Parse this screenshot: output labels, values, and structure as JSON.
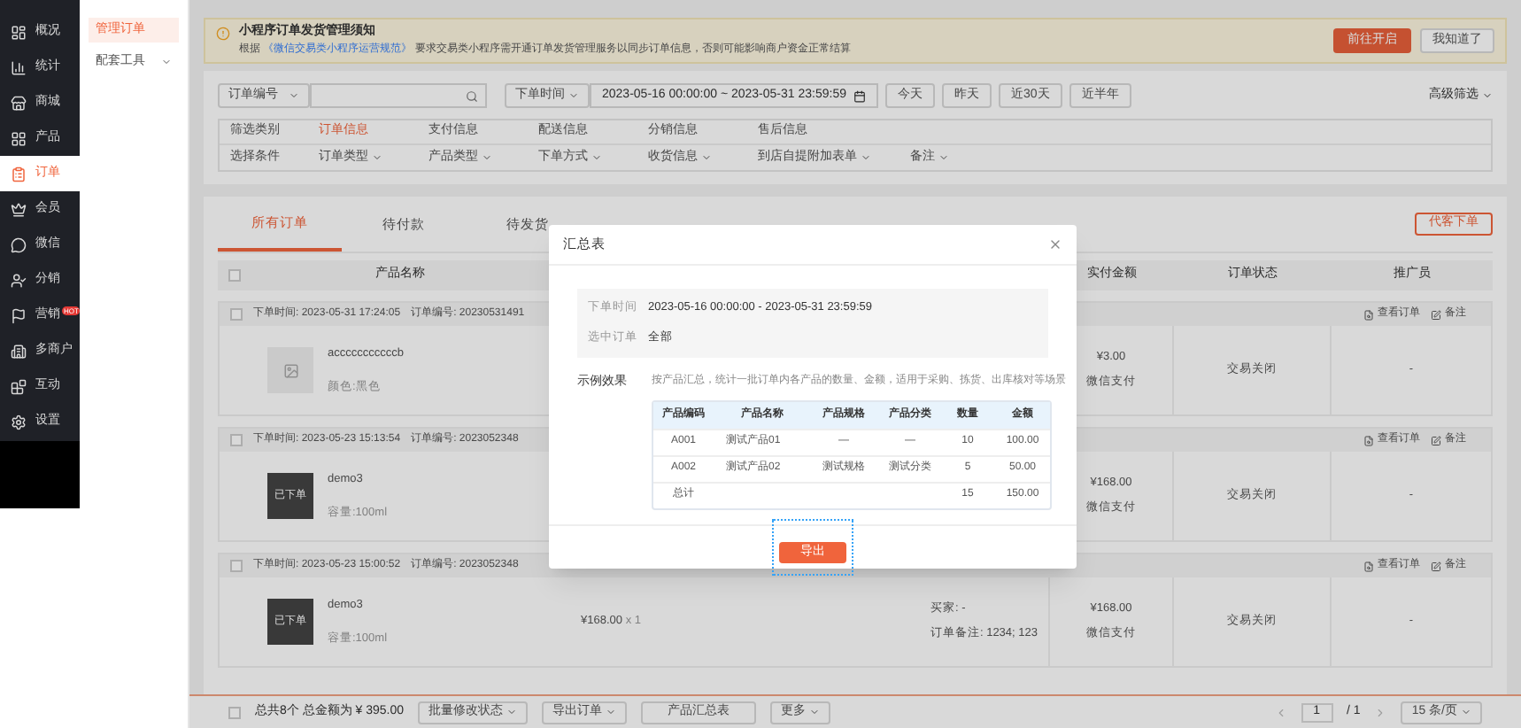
{
  "sidebar": {
    "items": [
      {
        "label": "概况",
        "selected": false
      },
      {
        "label": "统计",
        "selected": false
      },
      {
        "label": "商城",
        "selected": false
      },
      {
        "label": "产品",
        "selected": false
      },
      {
        "label": "订单",
        "selected": true
      },
      {
        "label": "会员",
        "selected": false
      },
      {
        "label": "微信",
        "selected": false
      },
      {
        "label": "分销",
        "selected": false
      },
      {
        "label": "营销",
        "selected": false,
        "badge": "HOT"
      },
      {
        "label": "多商户",
        "selected": false
      },
      {
        "label": "互动",
        "selected": false
      },
      {
        "label": "设置",
        "selected": false
      }
    ]
  },
  "subnav": {
    "items": [
      {
        "label": "管理订单",
        "selected": true,
        "expandable": false
      },
      {
        "label": "配套工具",
        "selected": false,
        "expandable": true
      }
    ]
  },
  "notice": {
    "title": "小程序订单发货管理须知",
    "text_before": "根据",
    "link": "《微信交易类小程序运营规范》",
    "text_after": "要求交易类小程序需开通订单发货管理服务以同步订单信息，否则可能影响商户资金正常结算",
    "primary_button": "前往开启",
    "secondary_button": "我知道了"
  },
  "filters": {
    "field_select": "订单编号",
    "time_select": "下单时间",
    "date_range": "2023-05-16 00:00:00 ~ 2023-05-31 23:59:59",
    "quick_buttons": [
      "今天",
      "昨天",
      "近30天",
      "近半年"
    ],
    "advanced": "高级筛选",
    "category_label": "筛选类别",
    "categories": [
      {
        "label": "订单信息",
        "selected": true
      },
      {
        "label": "支付信息",
        "selected": false
      },
      {
        "label": "配送信息",
        "selected": false
      },
      {
        "label": "分销信息",
        "selected": false
      },
      {
        "label": "售后信息",
        "selected": false
      }
    ],
    "condition_label": "选择条件",
    "conditions": [
      "订单类型",
      "产品类型",
      "下单方式",
      "收货信息",
      "到店自提附加表单",
      "备注"
    ]
  },
  "orders": {
    "tabs": [
      {
        "label": "所有订单",
        "selected": true
      },
      {
        "label": "待付款",
        "selected": false
      },
      {
        "label": "待发货",
        "selected": false
      }
    ],
    "proxy_button": "代客下单",
    "select_all_checked": false,
    "columns": {
      "product": "产品名称",
      "paid": "实付金额",
      "status": "订单状态",
      "promoter": "推广员"
    },
    "rows": [
      {
        "time_label": "下单时间:",
        "time": "2023-05-31 17:24:05",
        "number_label": "订单编号:",
        "number": "20230531491",
        "checked": false,
        "product": "acccccccccccb",
        "spec": "颜色:黑色",
        "kind": "placeholder",
        "paid": "¥3.00",
        "pay_method": "微信支付",
        "status": "交易关闭",
        "promoter": "-",
        "view": "查看订单",
        "remark": "备注"
      },
      {
        "time_label": "下单时间:",
        "time": "2023-05-23 15:13:54",
        "number_label": "订单编号:",
        "number": "2023052348",
        "checked": false,
        "product": "demo3",
        "spec": "容量:100ml",
        "kind": "thumbnail",
        "thumbnail_text": "已下单",
        "paid": "¥168.00",
        "pay_method": "微信支付",
        "status": "交易关闭",
        "promoter": "-",
        "view": "查看订单",
        "remark": "备注"
      },
      {
        "time_label": "下单时间:",
        "time": "2023-05-23 15:00:52",
        "number_label": "订单编号:",
        "number": "2023052348",
        "checked": false,
        "product": "demo3",
        "spec": "容量:100ml",
        "kind": "thumbnail",
        "thumbnail_text": "已下单",
        "price": "¥168.00",
        "qty": "x 1",
        "buyer": "买家: -",
        "order_note": "订单备注: 1234; 123",
        "paid": "¥168.00",
        "pay_method": "微信支付",
        "status": "交易关闭",
        "promoter": "-",
        "view": "查看订单",
        "remark": "备注"
      }
    ]
  },
  "footer": {
    "select_all_checked": false,
    "summary": "总共8个 总金额为 ¥ 395.00",
    "buttons": [
      "批量修改状态",
      "导出订单",
      "产品汇总表",
      "更多"
    ],
    "page": "1",
    "pages": "/ 1",
    "page_size": "15 条/页"
  },
  "dialog": {
    "title": "汇总表",
    "info": [
      {
        "label": "下单时间",
        "value": "2023-05-16 00:00:00 - 2023-05-31 23:59:59"
      },
      {
        "label": "选中订单",
        "value": "全部"
      }
    ],
    "example_label": "示例效果",
    "description": "按产品汇总，统计一批订单内各产品的数量、金额，适用于采购、拣货、出库核对等场景",
    "table": {
      "columns": [
        "产品编码",
        "产品名称",
        "产品规格",
        "产品分类",
        "数量",
        "金额"
      ],
      "rows": [
        [
          "A001",
          "测试产品01",
          "—",
          "—",
          "10",
          "100.00"
        ],
        [
          "A002",
          "测试产品02",
          "测试规格",
          "测试分类",
          "5",
          "50.00"
        ],
        [
          "总计",
          "",
          "",
          "",
          "15",
          "150.00"
        ]
      ]
    },
    "export_button": "导出"
  }
}
